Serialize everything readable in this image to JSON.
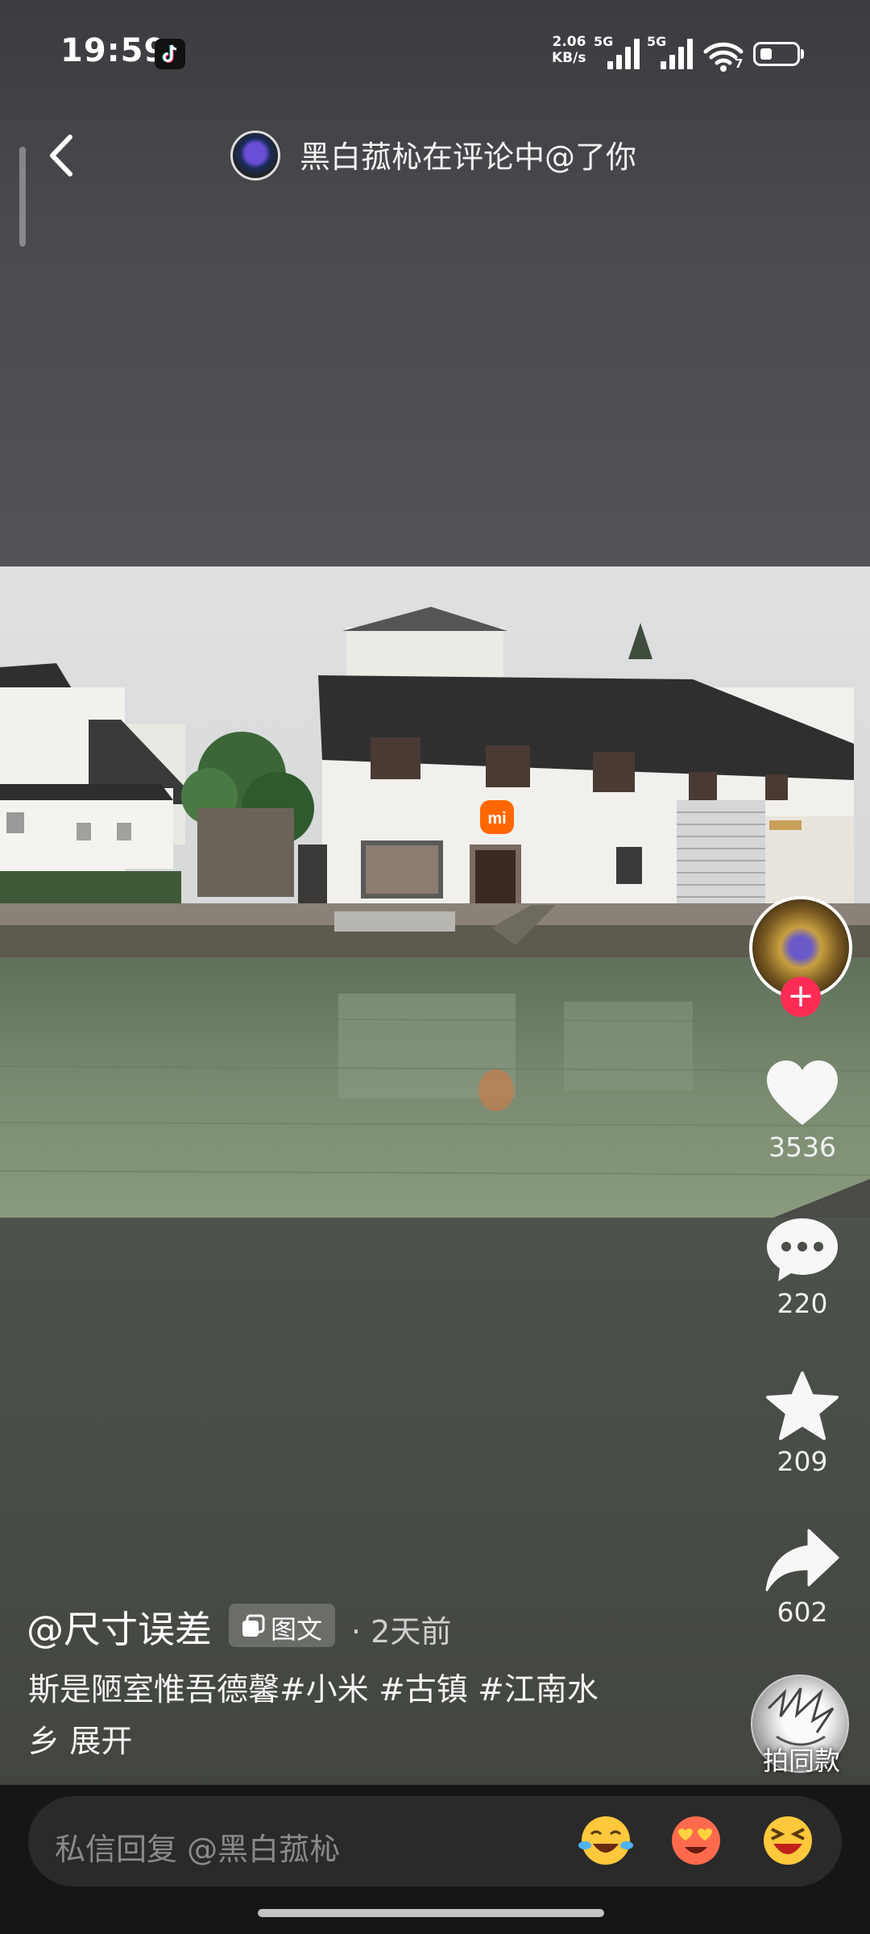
{
  "status_bar": {
    "time": "19:59",
    "net_speed_value": "2.06",
    "net_speed_unit": "KB/s",
    "sim1_label": "5G",
    "sim2_label": "5G",
    "wifi_badge": "7",
    "icons": [
      "tiktok-icon",
      "signal-icon",
      "wifi-icon",
      "battery-icon"
    ]
  },
  "header": {
    "back_icon": "chevron-left-icon",
    "notification": "黑白菰杺在评论中@了你"
  },
  "actions": {
    "like_count": "3536",
    "comment_count": "220",
    "favorite_count": "209",
    "share_count": "602",
    "same_style_label": "拍同款",
    "follow_symbol": "+"
  },
  "post": {
    "author": "@尺寸误差",
    "type_badge": "图文",
    "time": "· 2天前",
    "caption_line1": "斯是陋室惟吾德馨#小米 #古镇 #江南水",
    "caption_line2": "乡  展开"
  },
  "photo": {
    "store_logo_text": "mi"
  },
  "reply_bar": {
    "placeholder": "私信回复 @黑白菰杺",
    "emojis": [
      "laughing-crying-emoji",
      "heart-eyes-emoji",
      "grinning-squint-emoji"
    ]
  },
  "colors": {
    "accent": "#fe2c55",
    "brand": "#ff6700"
  }
}
